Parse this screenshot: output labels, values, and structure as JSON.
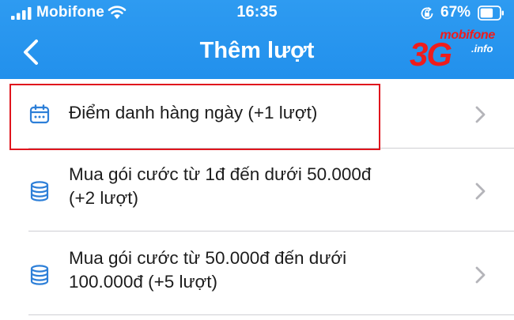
{
  "status_bar": {
    "carrier": "Mobifone",
    "time": "16:35",
    "battery_percent": "67%",
    "icons": [
      "signal-bars-icon",
      "wifi-icon",
      "orientation-lock-icon",
      "battery-icon"
    ]
  },
  "nav": {
    "back_icon": "chevron-left-icon",
    "title": "Thêm lượt"
  },
  "logo": {
    "top_text": "mobifone",
    "main_text": "3G",
    "suffix_text": ".info"
  },
  "list": {
    "items": [
      {
        "icon": "calendar-icon",
        "label": "Điểm danh hàng ngày (+1 lượt)",
        "highlighted": true
      },
      {
        "icon": "database-icon",
        "line1": "Mua gói cước từ 1đ đến dưới 50.000đ",
        "line2": "(+2 lượt)"
      },
      {
        "icon": "database-icon",
        "line1": "Mua gói cước từ 50.000đ đến dưới",
        "line2": "100.000đ (+5 lượt)"
      }
    ]
  },
  "colors": {
    "header_blue": "#2290ec",
    "icon_blue": "#2d7fd8",
    "highlight_red": "#e0151d",
    "logo_red": "#ef1c1c"
  }
}
